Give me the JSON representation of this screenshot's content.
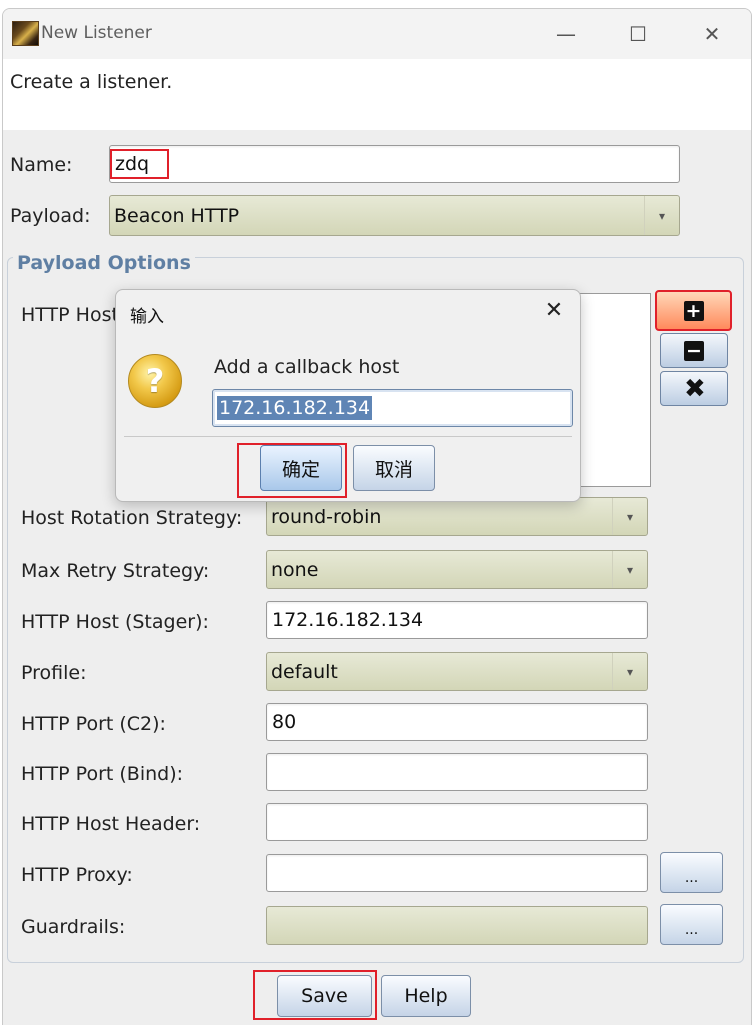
{
  "window": {
    "title": "New Listener",
    "description": "Create a listener.",
    "controls": {
      "minimize": "—",
      "maximize": "☐",
      "close": "✕"
    }
  },
  "form": {
    "name_label": "Name:",
    "name_value": "zdq",
    "payload_label": "Payload:",
    "payload_value": "Beacon HTTP",
    "payload_options_title": "Payload Options",
    "http_hosts_label": "HTTP Hosts:",
    "host_rotation_label": "Host Rotation Strategy:",
    "host_rotation_value": "round-robin",
    "max_retry_label": "Max Retry Strategy:",
    "max_retry_value": "none",
    "stager_label": "HTTP Host (Stager):",
    "stager_value": "172.16.182.134",
    "profile_label": "Profile:",
    "profile_value": "default",
    "port_c2_label": "HTTP Port (C2):",
    "port_c2_value": "80",
    "port_bind_label": "HTTP Port (Bind):",
    "port_bind_value": "",
    "host_header_label": "HTTP Host Header:",
    "host_header_value": "",
    "proxy_label": "HTTP Proxy:",
    "proxy_value": "",
    "guardrails_label": "Guardrails:",
    "guardrails_value": "",
    "ellipsis": "...",
    "save_label": "Save",
    "help_label": "Help"
  },
  "icons": {
    "add": "plus-icon",
    "remove": "minus-icon",
    "clear": "x-icon",
    "dropdown": "▾"
  },
  "dialog": {
    "title": "输入",
    "message": "Add a callback host",
    "input_value": "172.16.182.134",
    "ok_label": "确定",
    "cancel_label": "取消",
    "close_glyph": "✕",
    "question_glyph": "?"
  },
  "colors": {
    "highlight_box": "#e0202a",
    "group_title": "#5f7fa3",
    "combo_bg": "#d3d6b7",
    "selection": "#5f85b5"
  }
}
